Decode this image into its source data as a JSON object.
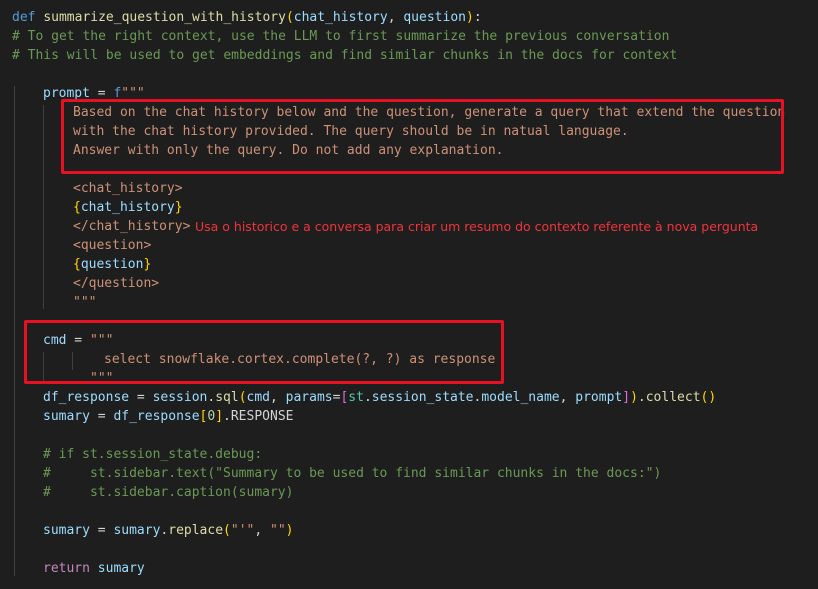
{
  "code": {
    "l1": {
      "def": "def",
      "fname": "summarize_question_with_history",
      "open": "(",
      "p1": "chat_history",
      "comma": ", ",
      "p2": "question",
      "close": ")",
      "colon": ":"
    },
    "l2": "# To get the right context, use the LLM to first summarize the previous conversation",
    "l3": "# This will be used to get embeddings and find similar chunks in the docs for context",
    "prompt": {
      "var": "prompt",
      "eq": " = ",
      "fprefix": "f",
      "quote": "\"\"\""
    },
    "prompt_lines": [
      "Based on the chat history below and the question, generate a query that extend the question",
      "with the chat history provided. The query should be in natual language.",
      "Answer with only the query. Do not add any explanation."
    ],
    "tag_open_history": "<chat_history>",
    "interp_history": {
      "open": "{",
      "name": "chat_history",
      "close": "}"
    },
    "tag_close_history": "</chat_history>",
    "tag_open_question": "<question>",
    "interp_question": {
      "open": "{",
      "name": "question",
      "close": "}"
    },
    "tag_close_question": "</question>",
    "prompt_end": "\"\"\"",
    "cmd": {
      "var": "cmd",
      "eq": " = ",
      "quote": "\"\"\"",
      "sql": "select snowflake.cortex.complete(?, ?) as response",
      "end": "\"\"\""
    },
    "df_line": {
      "var": "df_response",
      "eq": " = ",
      "obj": "session",
      "dot1": ".",
      "method": "sql",
      "open": "(",
      "arg1": "cmd",
      "c1": ", ",
      "kw": "params",
      "eq2": "=",
      "lbr": "[",
      "st": "st",
      "dot2": ".",
      "ss": "session_state",
      "dot3": ".",
      "mn": "model_name",
      "c2": ", ",
      "arg3": "prompt",
      "rbr": "]",
      "close": ")",
      "dot4": ".",
      "collect": "collect",
      "callp": "()"
    },
    "sumary_line": {
      "var": "sumary",
      "eq": " = ",
      "df": "df_response",
      "lb": "[",
      "idx": "0",
      "rb": "]",
      "attr": ".RESPONSE"
    },
    "comment_lines": [
      "# if st.session_state.debug:",
      "#     st.sidebar.text(\"Summary to be used to find similar chunks in the docs:\")",
      "#     st.sidebar.caption(sumary)"
    ],
    "replace_line": {
      "var": "sumary",
      "eq": " = ",
      "obj": "sumary",
      "dot": ".",
      "method": "replace",
      "open": "(",
      "a1": "\"'\"",
      "comma": ", ",
      "a2": "\"\"",
      "close": ")"
    },
    "return_line": {
      "kw": "return",
      "val": "sumary"
    }
  },
  "annotation": "Usa o historico e a conversa para criar um resumo do contexto referente à nova pergunta",
  "colors": {
    "highlight_box": "#e81123",
    "annotation_text": "#f0343c",
    "background": "#1e1e1e"
  }
}
